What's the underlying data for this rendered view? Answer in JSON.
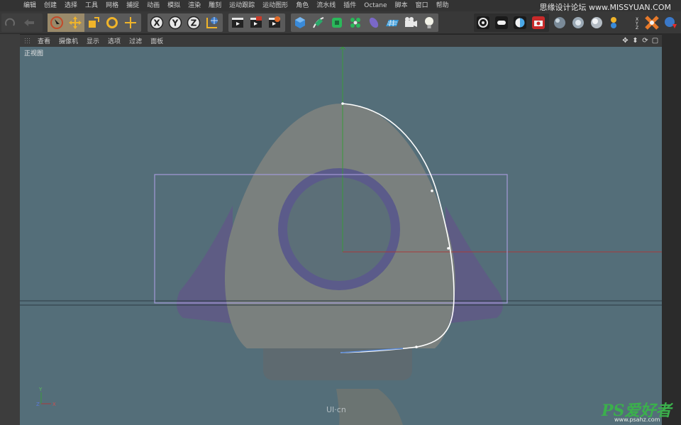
{
  "menu": {
    "items": [
      "编辑",
      "创建",
      "选择",
      "工具",
      "网格",
      "捕捉",
      "动画",
      "模拟",
      "渲染",
      "雕刻",
      "运动跟踪",
      "运动图形",
      "角色",
      "流水线",
      "插件",
      "Octane",
      "脚本",
      "窗口",
      "帮助"
    ]
  },
  "watermark_top": "思缘设计论坛 www.MISSYUAN.COM",
  "toolbar": {
    "icons": [
      "undo-icon",
      "live-select-icon",
      "move-icon",
      "scale-icon",
      "rotate-icon",
      "recent-tool-icon",
      "x-axis-icon",
      "y-axis-icon",
      "z-axis-icon",
      "coordinate-system-icon",
      "render-view-icon",
      "render-picture-viewer-icon",
      "render-settings-icon",
      "cube-icon",
      "pen-icon",
      "subdivision-icon",
      "cloner-icon",
      "deformer-icon",
      "floor-icon",
      "camera-icon",
      "light-icon",
      "octane-settings-icon",
      "octane-live-icon",
      "octane-dome-icon",
      "octane-camera-icon",
      "sphere-material-icon",
      "glossy-material-icon",
      "specular-material-icon",
      "object-tag-icon",
      "transform-tag-icon",
      "redshift-icon"
    ],
    "axes": [
      "X",
      "Y",
      "Z"
    ]
  },
  "viewport": {
    "menus": [
      "查看",
      "摄像机",
      "显示",
      "选项",
      "过滤",
      "面板"
    ],
    "label": "正视图",
    "nav_icons": [
      "move-view-icon",
      "zoom-view-icon",
      "rotate-view-icon",
      "toggle-layout-icon"
    ],
    "axis_labels": {
      "y": "Y",
      "x": "X",
      "z": "Z"
    }
  },
  "brand_mark": "UI·cn",
  "ps_watermark": "PS爱好者",
  "ps_url": "www.psahz.com",
  "colors": {
    "viewport_bg": "#546e79",
    "rocket_body": "#7a7f7d",
    "rocket_fins": "#5d5a83",
    "ring": "#5b5b8a",
    "spline": "#ffffff",
    "selection_box": "#a39ad8",
    "axis_y": "#3a9a3a",
    "axis_x": "#a83a3a"
  }
}
